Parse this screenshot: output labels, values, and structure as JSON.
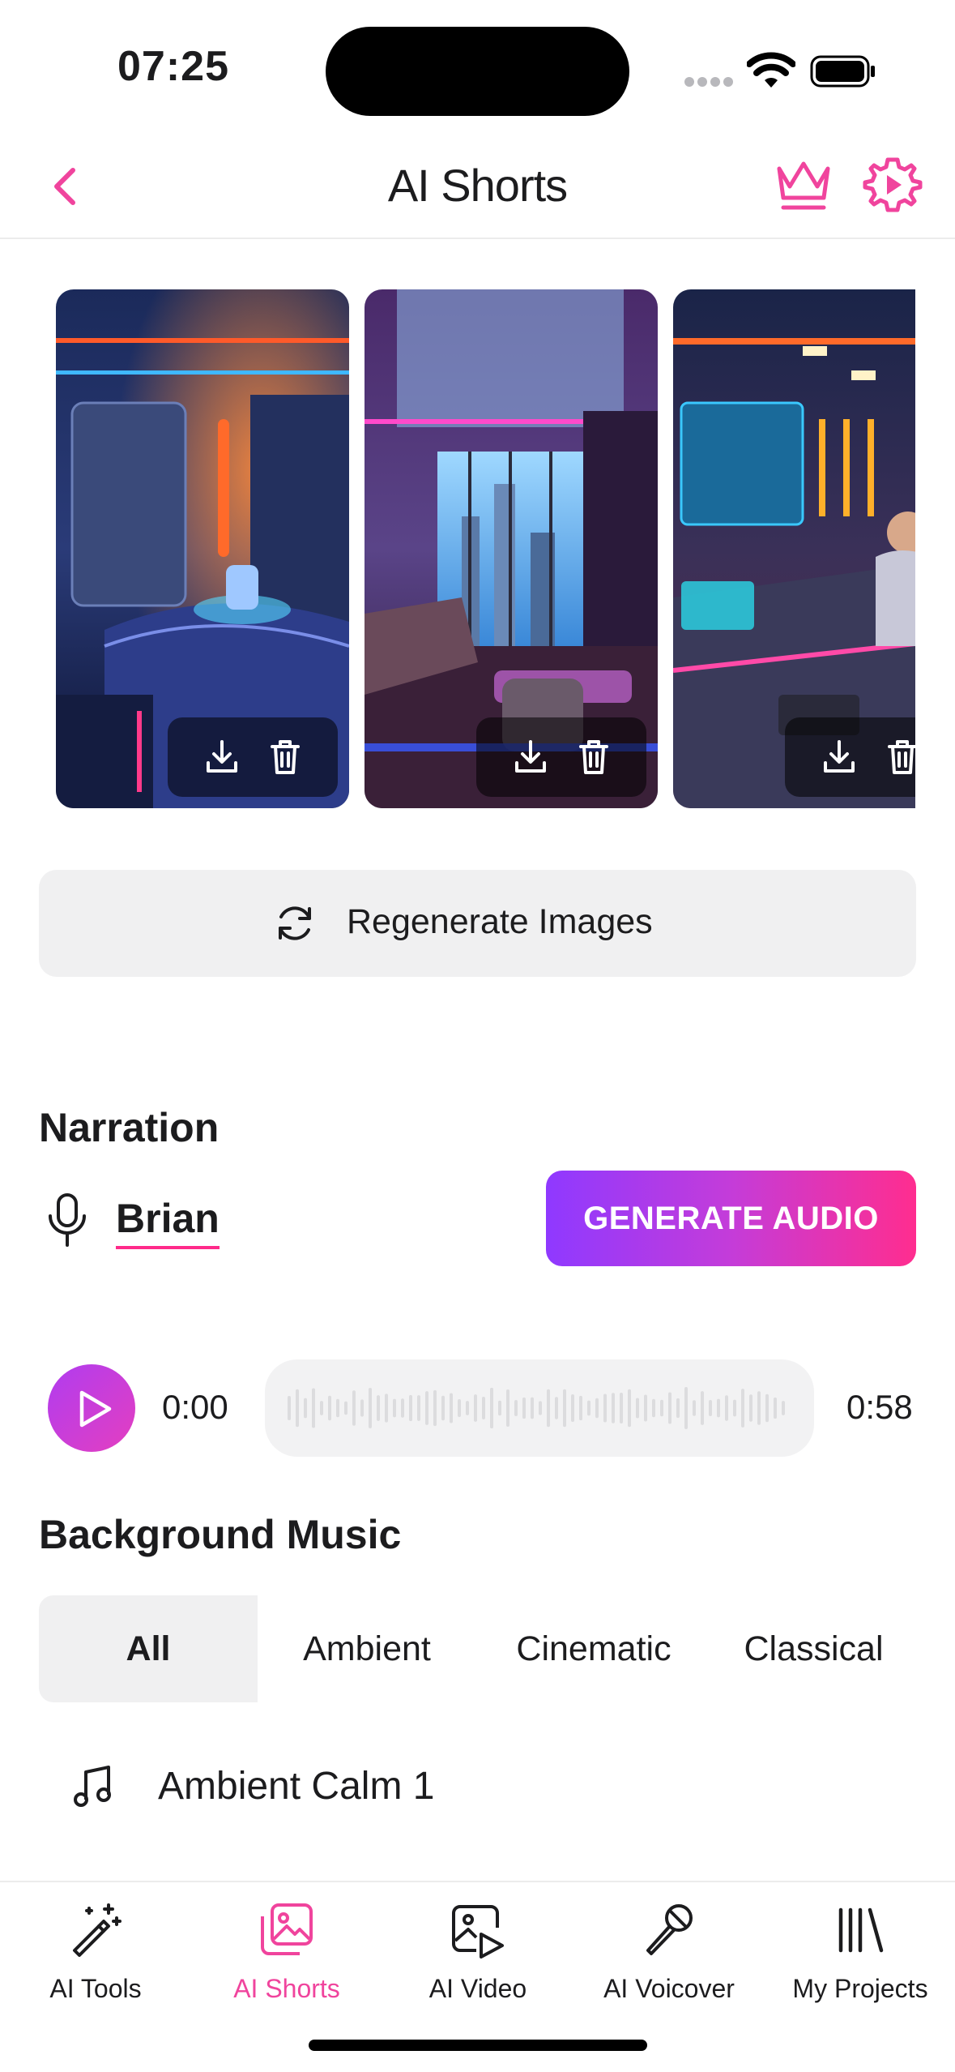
{
  "status_bar": {
    "time": "07:25"
  },
  "header": {
    "title": "AI Shorts",
    "back_icon": "chevron-left-icon",
    "crown_icon": "crown-icon",
    "settings_icon": "gear-icon"
  },
  "accent_color": "#f0449d",
  "gradient_colors": [
    "#8f39ff",
    "#ff2d8f"
  ],
  "images": [
    {
      "theme": "neon sci-fi bedroom"
    },
    {
      "theme": "neon penthouse living room"
    },
    {
      "theme": "neon tech office"
    }
  ],
  "regenerate": {
    "label": "Regenerate Images"
  },
  "narration": {
    "title": "Narration",
    "voice": "Brian",
    "generate_label": "GENERATE AUDIO"
  },
  "player": {
    "current_time": "0:00",
    "duration": "0:58",
    "progress": 0
  },
  "background_music": {
    "title": "Background Music",
    "categories": [
      "All",
      "Ambient",
      "Cinematic",
      "Classical"
    ],
    "selected_category": "All",
    "tracks": [
      {
        "name": "Ambient Calm 1"
      }
    ]
  },
  "tab_bar": {
    "items": [
      {
        "label": "AI Tools",
        "icon": "magic-wand-icon"
      },
      {
        "label": "AI Shorts",
        "icon": "image-gallery-icon",
        "active": true
      },
      {
        "label": "AI Video",
        "icon": "video-image-icon"
      },
      {
        "label": "AI Voicover",
        "icon": "microphone-icon"
      },
      {
        "label": "My Projects",
        "icon": "library-icon"
      }
    ]
  }
}
